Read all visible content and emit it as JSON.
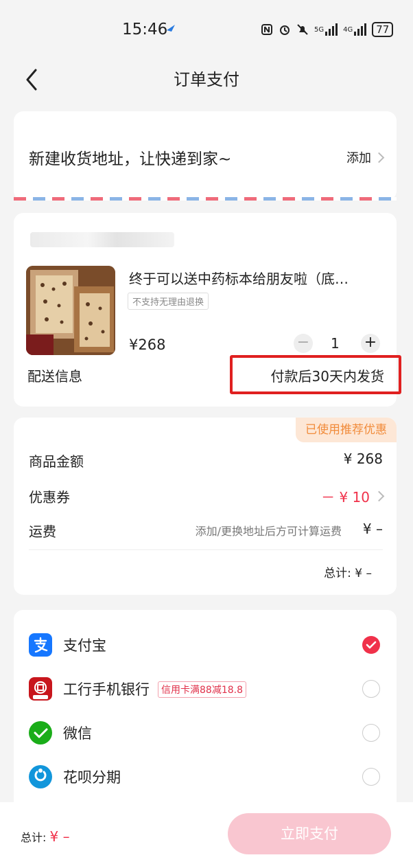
{
  "status": {
    "time": "15:46",
    "battery": "77",
    "network": "5G",
    "network2": "4G"
  },
  "nav": {
    "title": "订单支付"
  },
  "address": {
    "prompt": "新建收货地址，让快递到家~",
    "add_label": "添加"
  },
  "product": {
    "name": "终于可以送中药标本给朋友啦（底…",
    "tag": "不支持无理由退换",
    "price": "¥268",
    "quantity": "1",
    "minus": "−",
    "plus": "+",
    "delivery_label": "配送信息",
    "delivery_value": "付款后30天内发货"
  },
  "amount": {
    "promo_tag": "已使用推荐优惠",
    "goods_label": "商品金额",
    "goods_value": "¥ 268",
    "coupon_label": "优惠券",
    "coupon_value": "－ ¥ 10",
    "ship_label": "运费",
    "ship_note": "添加/更换地址后方可计算运费",
    "ship_value": "¥ –",
    "total": "总计: ¥ –"
  },
  "payment": {
    "methods": [
      {
        "label": "支付宝",
        "icon": "alipay-icon",
        "selected": true
      },
      {
        "label": "工行手机银行",
        "icon": "icbc-icon",
        "selected": false,
        "tag": "信用卡满88减18.8"
      },
      {
        "label": "微信",
        "icon": "wechat-icon",
        "selected": false
      },
      {
        "label": "花呗分期",
        "icon": "huabei-icon",
        "selected": false
      }
    ]
  },
  "footer": {
    "total_label": "总计:",
    "total_value": "¥ –",
    "pay_button": "立即支付"
  },
  "colors": {
    "accent": "#f0314a",
    "highlight": "#e02020",
    "promo": "#f18b3a"
  }
}
